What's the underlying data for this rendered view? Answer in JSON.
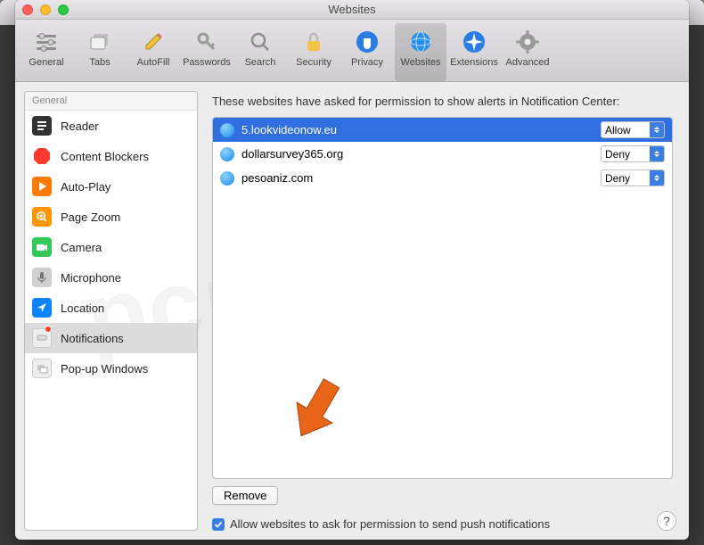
{
  "window": {
    "title": "Websites"
  },
  "toolbar": {
    "items": [
      {
        "label": "General",
        "name": "toolbar-general"
      },
      {
        "label": "Tabs",
        "name": "toolbar-tabs"
      },
      {
        "label": "AutoFill",
        "name": "toolbar-autofill"
      },
      {
        "label": "Passwords",
        "name": "toolbar-passwords"
      },
      {
        "label": "Search",
        "name": "toolbar-search"
      },
      {
        "label": "Security",
        "name": "toolbar-security"
      },
      {
        "label": "Privacy",
        "name": "toolbar-privacy"
      },
      {
        "label": "Websites",
        "name": "toolbar-websites"
      },
      {
        "label": "Extensions",
        "name": "toolbar-extensions"
      },
      {
        "label": "Advanced",
        "name": "toolbar-advanced"
      }
    ]
  },
  "sidebar": {
    "header": "General",
    "items": [
      {
        "label": "Reader"
      },
      {
        "label": "Content Blockers"
      },
      {
        "label": "Auto-Play"
      },
      {
        "label": "Page Zoom"
      },
      {
        "label": "Camera"
      },
      {
        "label": "Microphone"
      },
      {
        "label": "Location"
      },
      {
        "label": "Notifications"
      },
      {
        "label": "Pop-up Windows"
      }
    ]
  },
  "main": {
    "heading": "These websites have asked for permission to show alerts in Notification Center:",
    "sites": [
      {
        "domain": "5.lookvideonow.eu",
        "perm": "Allow",
        "selected": true
      },
      {
        "domain": "dollarsurvey365.org",
        "perm": "Deny",
        "selected": false
      },
      {
        "domain": "pesoaniz.com",
        "perm": "Deny",
        "selected": false
      }
    ],
    "remove_label": "Remove",
    "checkbox_label": "Allow websites to ask for permission to send push notifications",
    "checkbox_checked": true
  },
  "help_label": "?"
}
